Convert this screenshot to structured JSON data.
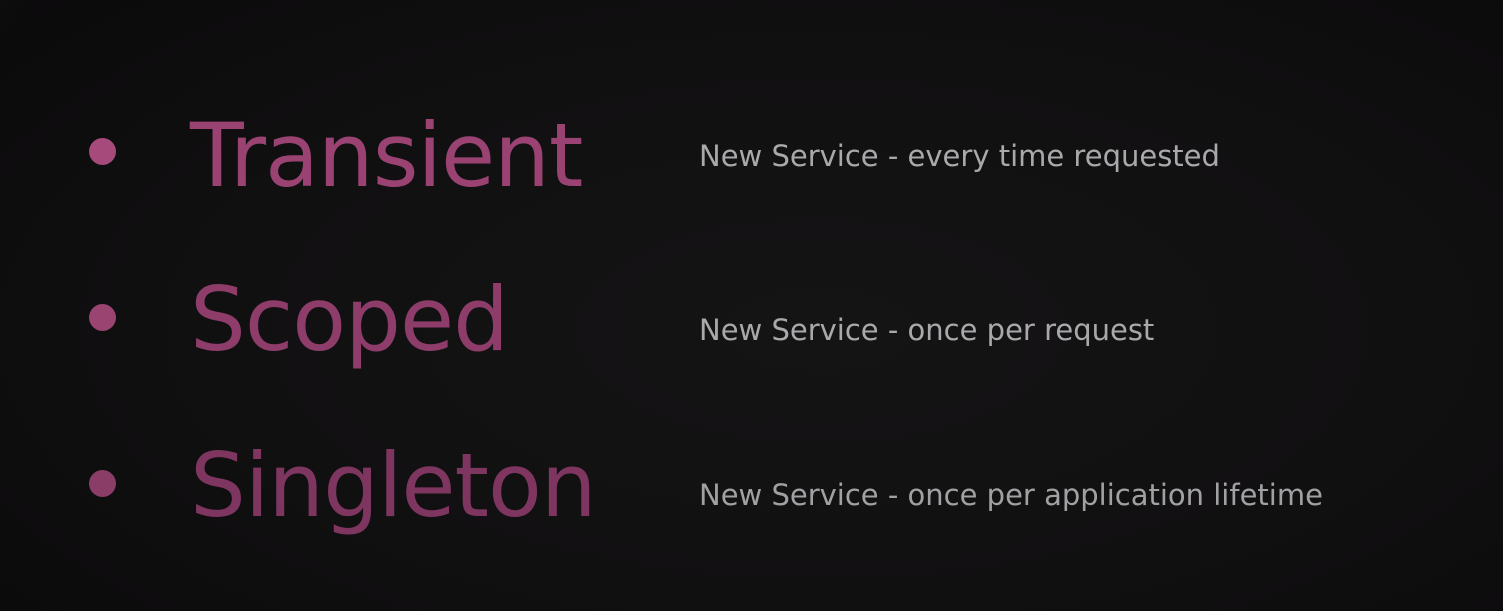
{
  "items": [
    {
      "term": "Transient",
      "description": "New Service - every time requested"
    },
    {
      "term": "Scoped",
      "description": "New Service - once per request"
    },
    {
      "term": "Singleton",
      "description": "New Service - once per application lifetime"
    }
  ],
  "colors": {
    "background": "#121112",
    "accent": "#9a4373",
    "description_text": "#a9a8ab"
  },
  "icons": {
    "bullet": "bullet-dot-icon"
  }
}
